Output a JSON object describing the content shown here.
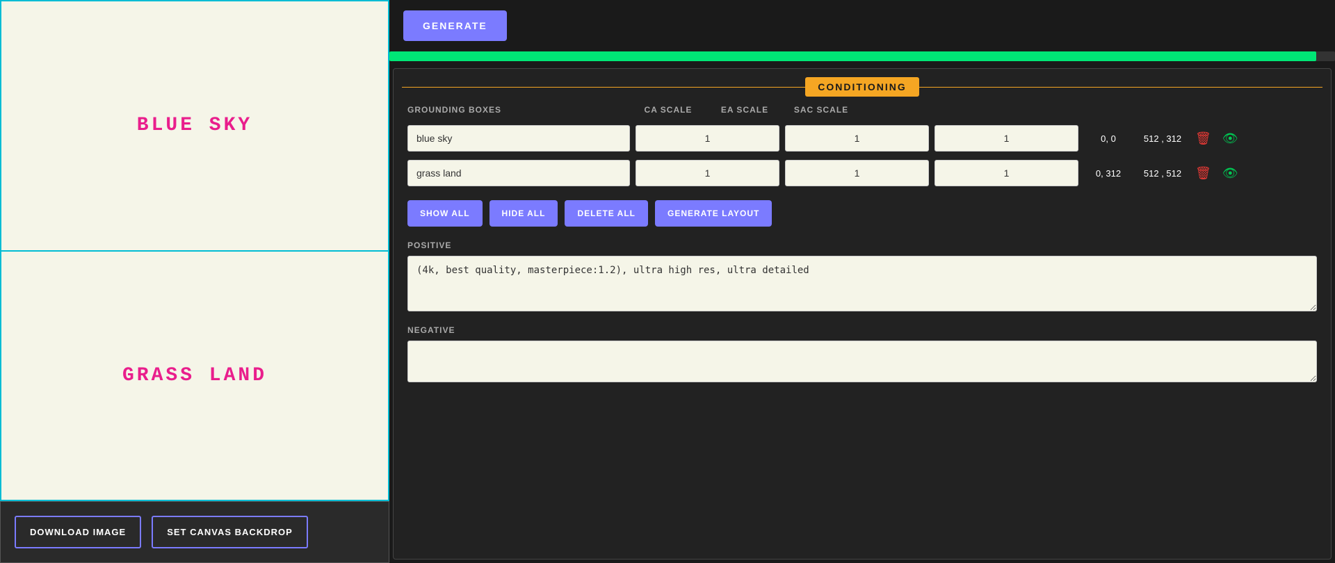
{
  "left": {
    "canvas_top_label": "BLUE  SKY",
    "canvas_bottom_label": "GRASS  LAND",
    "btn_download": "DOWNLOAD IMAGE",
    "btn_set_canvas": "SET CANVAS BACKDROP"
  },
  "top_bar": {
    "generate_label": "GENERATE"
  },
  "progress": {
    "fill_percent": 98
  },
  "conditioning": {
    "badge_label": "CONDITIONING",
    "columns": {
      "grounding_boxes": "GROUNDING BOXES",
      "ca_scale": "CA SCALE",
      "ea_scale": "EA SCALE",
      "sac_scale": "SAC SCALE"
    },
    "rows": [
      {
        "text": "blue sky",
        "ca": "1",
        "ea": "1",
        "sac": "1",
        "coord1": "0, 0",
        "coord2": "512 , 312"
      },
      {
        "text": "grass land",
        "ca": "1",
        "ea": "1",
        "sac": "1",
        "coord1": "0, 312",
        "coord2": "512 , 512"
      }
    ],
    "buttons": {
      "show_all": "SHOW ALL",
      "hide_all": "HIDE ALL",
      "delete_all": "DELETE ALL",
      "generate_layout": "GENERATE LAYOUT"
    },
    "positive_label": "POSITIVE",
    "positive_value": "(4k, best quality, masterpiece:1.2), ultra high res, ultra detailed",
    "negative_label": "NEGATIVE",
    "negative_value": ""
  }
}
